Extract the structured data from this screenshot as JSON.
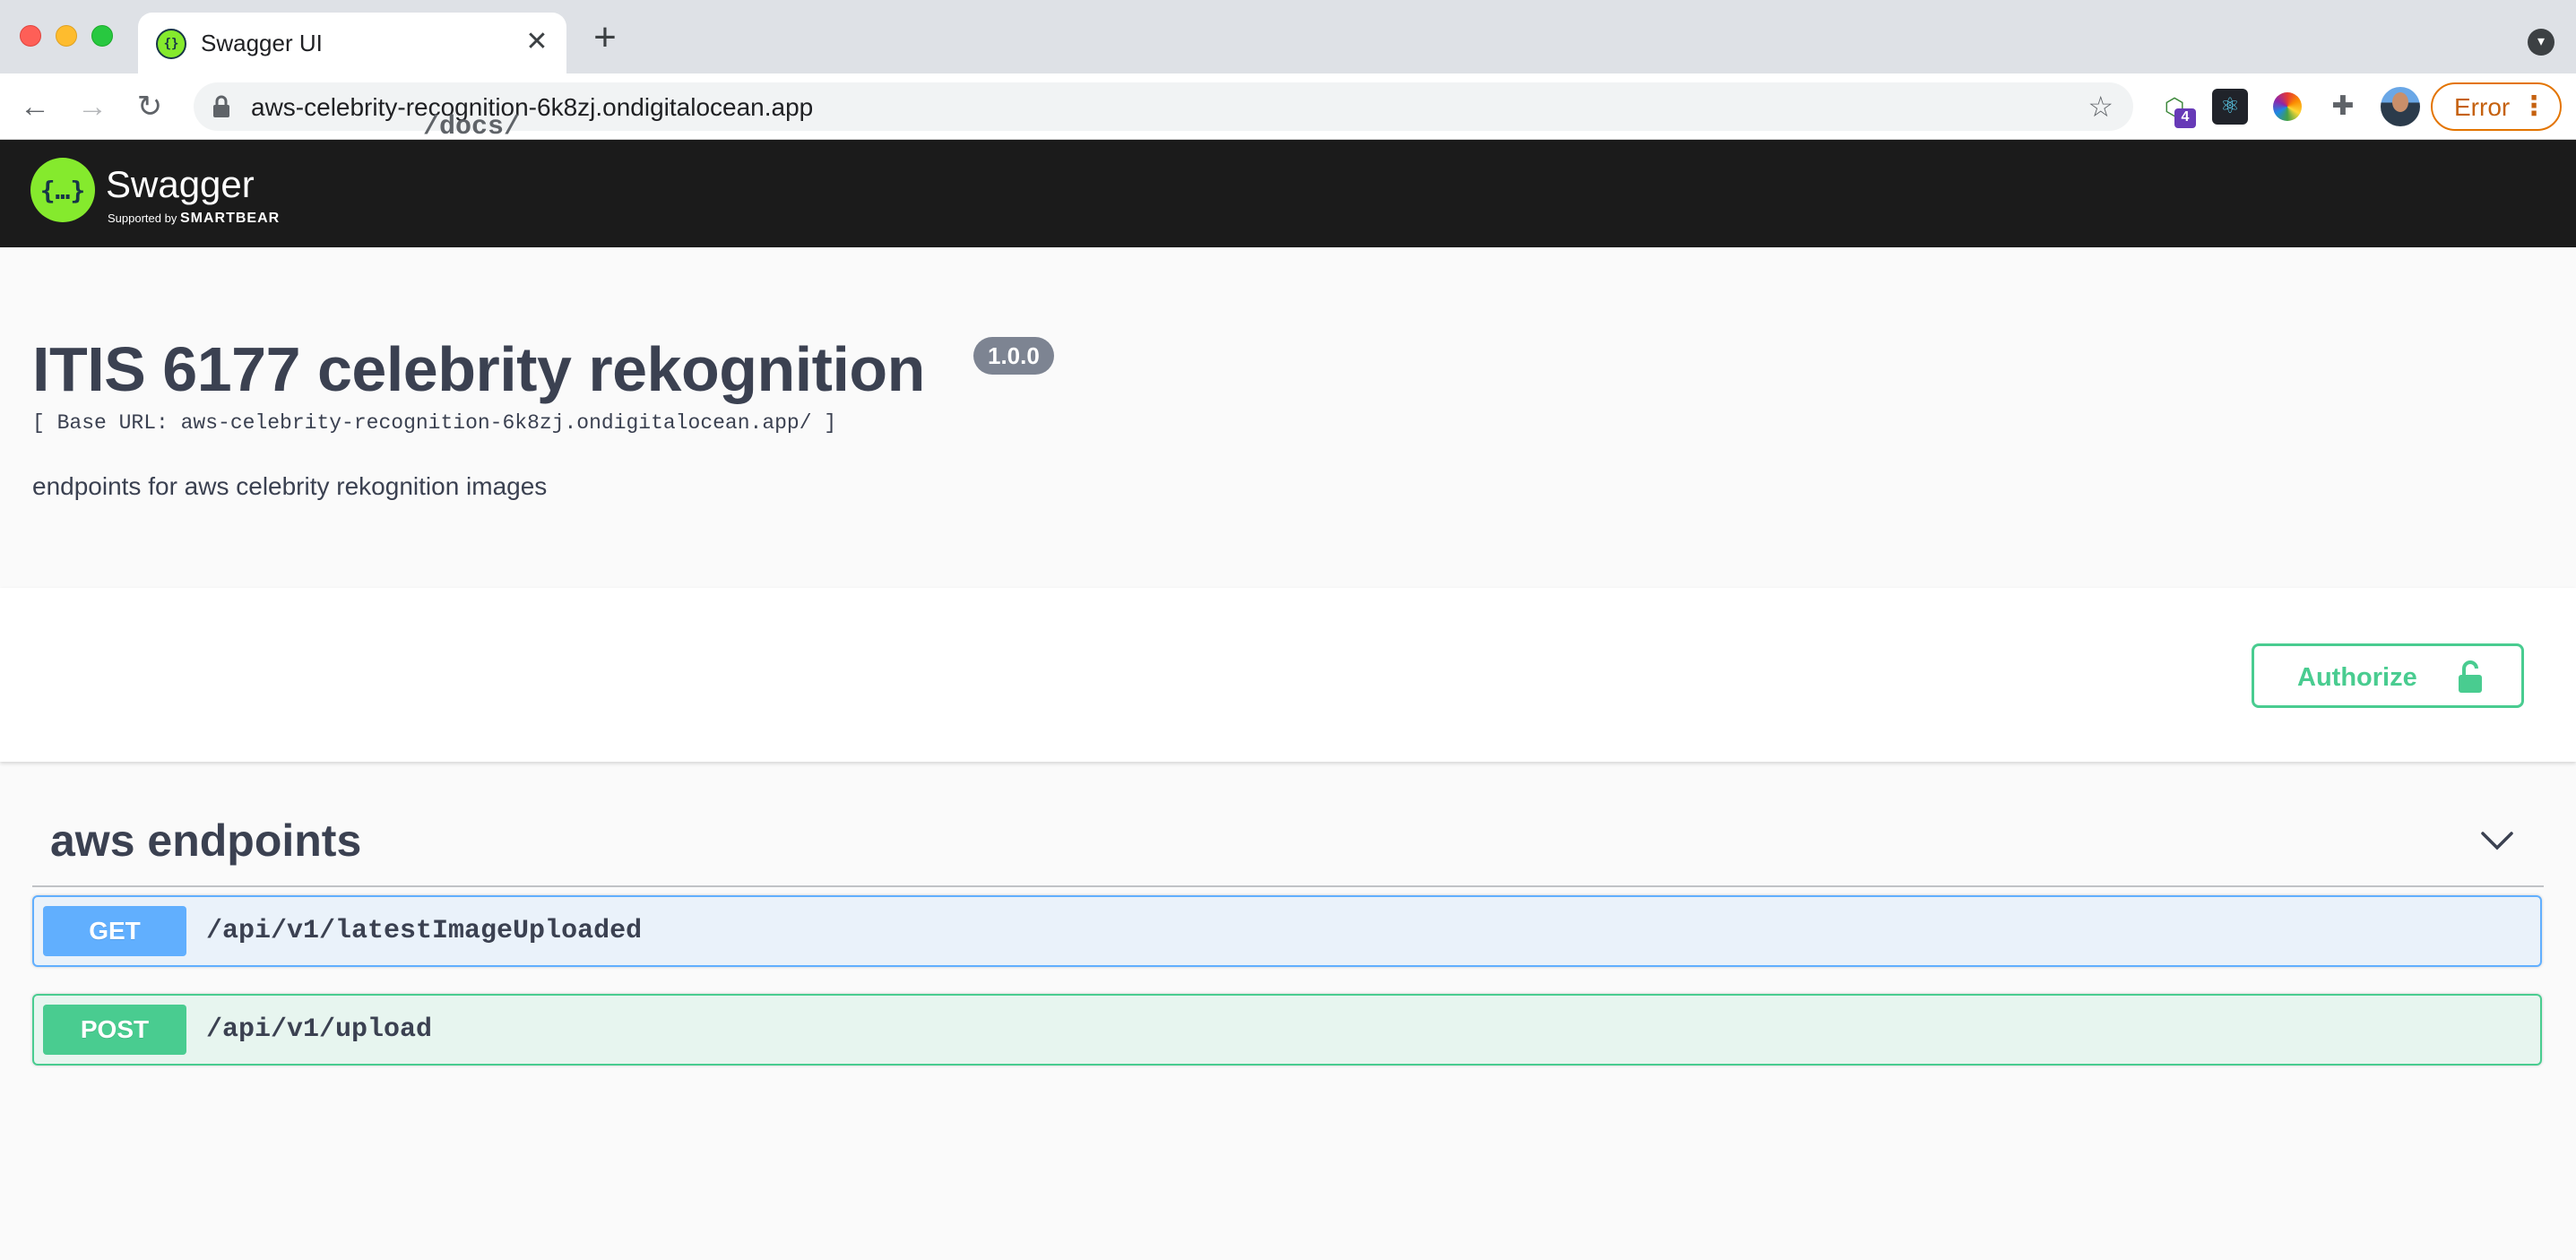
{
  "browser": {
    "tab_title": "Swagger UI",
    "tab_close": "✕",
    "new_tab": "+",
    "url_host": "aws-celebrity-recognition-6k8zj.ondigitalocean.app",
    "url_path": "/docs/",
    "extension_badge": "4",
    "error_label": "Error",
    "icons": [
      "back-icon",
      "forward-icon",
      "reload-icon",
      "lock-icon",
      "star-icon",
      "node-extension-icon",
      "react-devtools-icon",
      "color-picker-icon",
      "puzzle-icon",
      "avatar",
      "kebab-icon"
    ]
  },
  "topbar": {
    "logo_glyph": "{…}",
    "name": "Swagger",
    "supported_by": "Supported by",
    "brand": "SMARTBEAR"
  },
  "info": {
    "title": "ITIS 6177 celebrity rekognition",
    "version": "1.0.0",
    "base_url": "[ Base URL: aws-celebrity-recognition-6k8zj.ondigitalocean.app/ ]",
    "description": "endpoints for aws celebrity rekognition images"
  },
  "auth": {
    "authorize_label": "Authorize"
  },
  "tag": {
    "title": "aws endpoints"
  },
  "operations": [
    {
      "method": "GET",
      "path": "/api/v1/latestImageUploaded",
      "color": "#61affe"
    },
    {
      "method": "POST",
      "path": "/api/v1/upload",
      "color": "#49cc90"
    }
  ]
}
